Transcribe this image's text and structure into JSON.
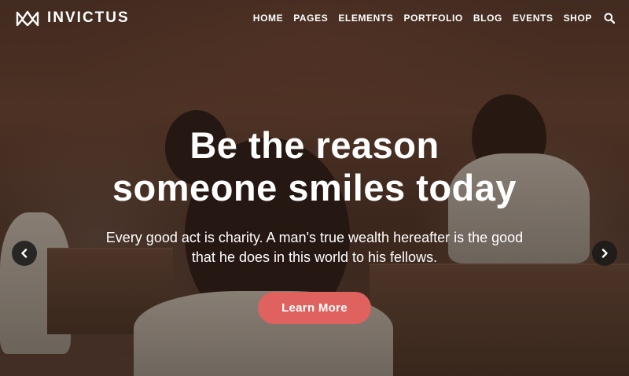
{
  "brand": {
    "name": "INVICTUS",
    "icon": "crown-logo-icon"
  },
  "nav": {
    "items": [
      {
        "label": "HOME"
      },
      {
        "label": "PAGES"
      },
      {
        "label": "ELEMENTS"
      },
      {
        "label": "PORTFOLIO"
      },
      {
        "label": "BLOG"
      },
      {
        "label": "EVENTS"
      },
      {
        "label": "SHOP"
      }
    ],
    "search_icon": "search-icon"
  },
  "hero": {
    "headline_line1": "Be the reason",
    "headline_line2": "someone smiles today",
    "subtext_line1": "Every good act is charity. A man's true wealth hereafter is the good",
    "subtext_line2": "that he does in this world to his fellows.",
    "cta_label": "Learn More",
    "prev_icon": "chevron-left-icon",
    "next_icon": "chevron-right-icon"
  },
  "colors": {
    "accent": "#e0625f",
    "text": "#ffffff",
    "arrow_bg": "#191919"
  }
}
